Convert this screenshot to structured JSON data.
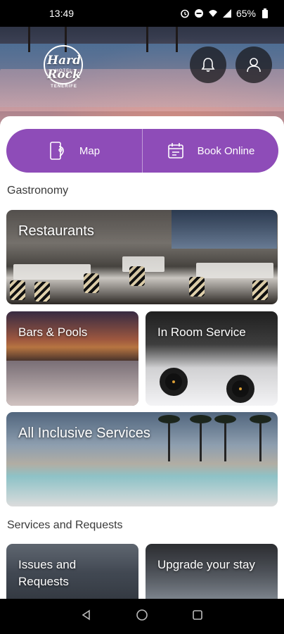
{
  "status_bar": {
    "time": "13:49",
    "battery": "65%",
    "icons": [
      "alarm-icon",
      "do-not-disturb-icon",
      "wifi-icon",
      "signal-icon",
      "battery-icon"
    ]
  },
  "header": {
    "logo_text": "Hard Rock",
    "logo_sub": "HOTEL",
    "logo_city": "TENERIFE",
    "notification_icon": "bell-icon",
    "profile_icon": "person-icon"
  },
  "actions": {
    "map_label": "Map",
    "book_label": "Book Online",
    "accent": "#8e4cb8"
  },
  "gastronomy": {
    "title": "Gastronomy",
    "cards": [
      {
        "label": "Restaurants"
      },
      {
        "label": "Bars & Pools"
      },
      {
        "label": "In Room Service"
      },
      {
        "label": "All Inclusive Services"
      }
    ]
  },
  "services": {
    "title": "Services and Requests",
    "cards": [
      {
        "label": "Issues and Requests"
      },
      {
        "label": "Upgrade your stay"
      }
    ]
  },
  "nav": {
    "back": "back-icon",
    "home": "home-icon",
    "recents": "recents-icon"
  }
}
